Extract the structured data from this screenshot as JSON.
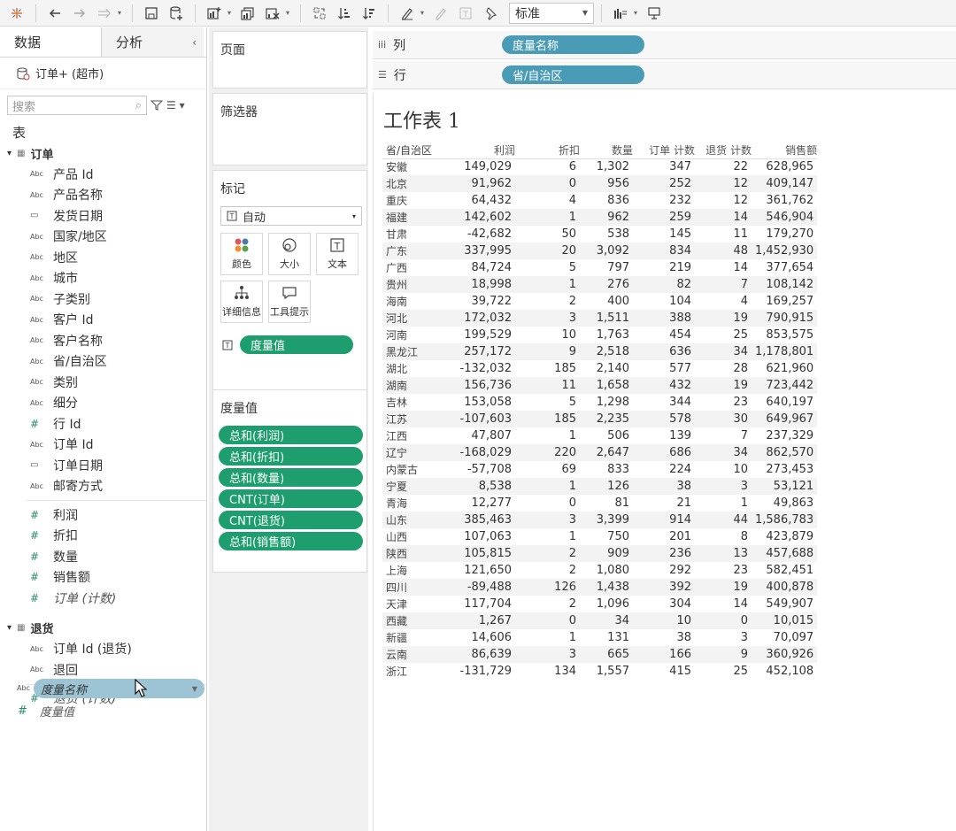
{
  "toolbar": {
    "zoom_select": "标准"
  },
  "leftpane": {
    "tab_data": "数据",
    "tab_analysis": "分析",
    "datasource": "订单+ (超市)",
    "search_placeholder": "搜索",
    "tables_title": "表",
    "group_orders": "订单",
    "order_fields": [
      {
        "type": "Abc",
        "label": "产品 Id"
      },
      {
        "type": "Abc",
        "label": "产品名称"
      },
      {
        "type": "date",
        "label": "发货日期"
      },
      {
        "type": "Abc",
        "label": "国家/地区"
      },
      {
        "type": "Abc",
        "label": "地区"
      },
      {
        "type": "Abc",
        "label": "城市"
      },
      {
        "type": "Abc",
        "label": "子类别"
      },
      {
        "type": "Abc",
        "label": "客户 Id"
      },
      {
        "type": "Abc",
        "label": "客户名称"
      },
      {
        "type": "Abc",
        "label": "省/自治区"
      },
      {
        "type": "Abc",
        "label": "类别"
      },
      {
        "type": "Abc",
        "label": "细分"
      },
      {
        "type": "#",
        "label": "行 Id"
      },
      {
        "type": "Abc",
        "label": "订单 Id"
      },
      {
        "type": "date",
        "label": "订单日期"
      },
      {
        "type": "Abc",
        "label": "邮寄方式"
      }
    ],
    "order_measures": [
      "利润",
      "折扣",
      "数量",
      "销售额"
    ],
    "order_count": "订单 (计数)",
    "group_returns": "退货",
    "return_fields": [
      "订单 Id (退货)",
      "退回"
    ],
    "return_count": "退货 (计数)",
    "measure_names": "度量名称",
    "measure_values": "度量值"
  },
  "shelves": {
    "pages": "页面",
    "filters": "筛选器",
    "marks": "标记",
    "marks_type": "自动",
    "mark_buttons": [
      "颜色",
      "大小",
      "文本",
      "详细信息",
      "工具提示"
    ],
    "marks_pill": "度量值",
    "measure_values_title": "度量值",
    "measure_values_pills": [
      "总和(利润)",
      "总和(折扣)",
      "总和(数量)",
      "CNT(订单)",
      "CNT(退货)",
      "总和(销售额)"
    ],
    "columns_label": "列",
    "columns_pill": "度量名称",
    "rows_label": "行",
    "rows_pill": "省/自治区"
  },
  "viz": {
    "title": "工作表 1",
    "headers": [
      "省/自治区",
      "利润",
      "折扣",
      "数量",
      "订单 计数",
      "退货 计数",
      "销售额"
    ],
    "rows": [
      [
        "安徽",
        "149,029",
        "6",
        "1,302",
        "347",
        "22",
        "628,965"
      ],
      [
        "北京",
        "91,962",
        "0",
        "956",
        "252",
        "12",
        "409,147"
      ],
      [
        "重庆",
        "64,432",
        "4",
        "836",
        "232",
        "12",
        "361,762"
      ],
      [
        "福建",
        "142,602",
        "1",
        "962",
        "259",
        "14",
        "546,904"
      ],
      [
        "甘肃",
        "-42,682",
        "50",
        "538",
        "145",
        "11",
        "179,270"
      ],
      [
        "广东",
        "337,995",
        "20",
        "3,092",
        "834",
        "48",
        "1,452,930"
      ],
      [
        "广西",
        "84,724",
        "5",
        "797",
        "219",
        "14",
        "377,654"
      ],
      [
        "贵州",
        "18,998",
        "1",
        "276",
        "82",
        "7",
        "108,142"
      ],
      [
        "海南",
        "39,722",
        "2",
        "400",
        "104",
        "4",
        "169,257"
      ],
      [
        "河北",
        "172,032",
        "3",
        "1,511",
        "388",
        "19",
        "790,915"
      ],
      [
        "河南",
        "199,529",
        "10",
        "1,763",
        "454",
        "25",
        "853,575"
      ],
      [
        "黑龙江",
        "257,172",
        "9",
        "2,518",
        "636",
        "34",
        "1,178,801"
      ],
      [
        "湖北",
        "-132,032",
        "185",
        "2,140",
        "577",
        "28",
        "621,960"
      ],
      [
        "湖南",
        "156,736",
        "11",
        "1,658",
        "432",
        "19",
        "723,442"
      ],
      [
        "吉林",
        "153,058",
        "5",
        "1,298",
        "344",
        "23",
        "640,197"
      ],
      [
        "江苏",
        "-107,603",
        "185",
        "2,235",
        "578",
        "30",
        "649,967"
      ],
      [
        "江西",
        "47,807",
        "1",
        "506",
        "139",
        "7",
        "237,329"
      ],
      [
        "辽宁",
        "-168,029",
        "220",
        "2,647",
        "686",
        "34",
        "862,570"
      ],
      [
        "内蒙古",
        "-57,708",
        "69",
        "833",
        "224",
        "10",
        "273,453"
      ],
      [
        "宁夏",
        "8,538",
        "1",
        "126",
        "38",
        "3",
        "53,121"
      ],
      [
        "青海",
        "12,277",
        "0",
        "81",
        "21",
        "1",
        "49,863"
      ],
      [
        "山东",
        "385,463",
        "3",
        "3,399",
        "914",
        "44",
        "1,586,783"
      ],
      [
        "山西",
        "107,063",
        "1",
        "750",
        "201",
        "8",
        "423,879"
      ],
      [
        "陕西",
        "105,815",
        "2",
        "909",
        "236",
        "13",
        "457,688"
      ],
      [
        "上海",
        "121,650",
        "2",
        "1,080",
        "292",
        "23",
        "582,451"
      ],
      [
        "四川",
        "-89,488",
        "126",
        "1,438",
        "392",
        "19",
        "400,878"
      ],
      [
        "天津",
        "117,704",
        "2",
        "1,096",
        "304",
        "14",
        "549,907"
      ],
      [
        "西藏",
        "1,267",
        "0",
        "34",
        "10",
        "0",
        "10,015"
      ],
      [
        "新疆",
        "14,606",
        "1",
        "131",
        "38",
        "3",
        "70,097"
      ],
      [
        "云南",
        "86,639",
        "3",
        "665",
        "166",
        "9",
        "360,926"
      ],
      [
        "浙江",
        "-131,729",
        "134",
        "1,557",
        "415",
        "25",
        "452,108"
      ]
    ]
  },
  "colors": {
    "green_pill": "#1e9e6f",
    "blue_pill": "#4a9bb6",
    "measure_names_pill": "#9cc4d4"
  }
}
